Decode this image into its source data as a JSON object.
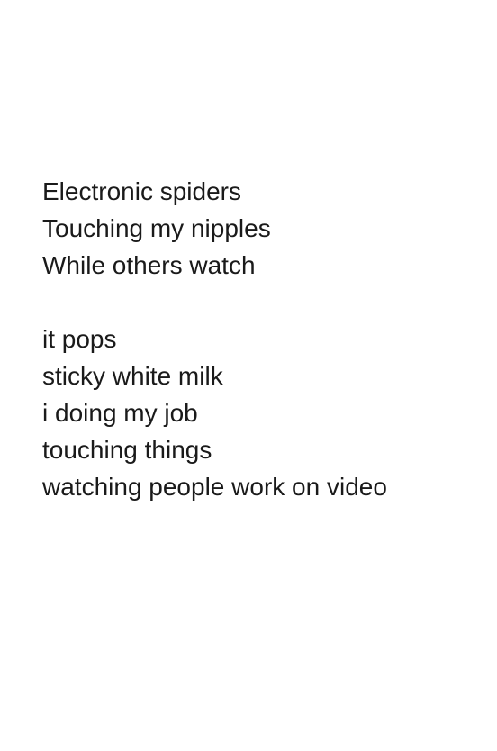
{
  "poem": {
    "stanzas": [
      {
        "lines": [
          "Electronic spiders",
          "Touching my nipples",
          "While others watch"
        ]
      },
      {
        "lines": [
          "it pops",
          "sticky white milk",
          "i doing my job",
          "touching things",
          "watching people work on video"
        ]
      }
    ]
  }
}
